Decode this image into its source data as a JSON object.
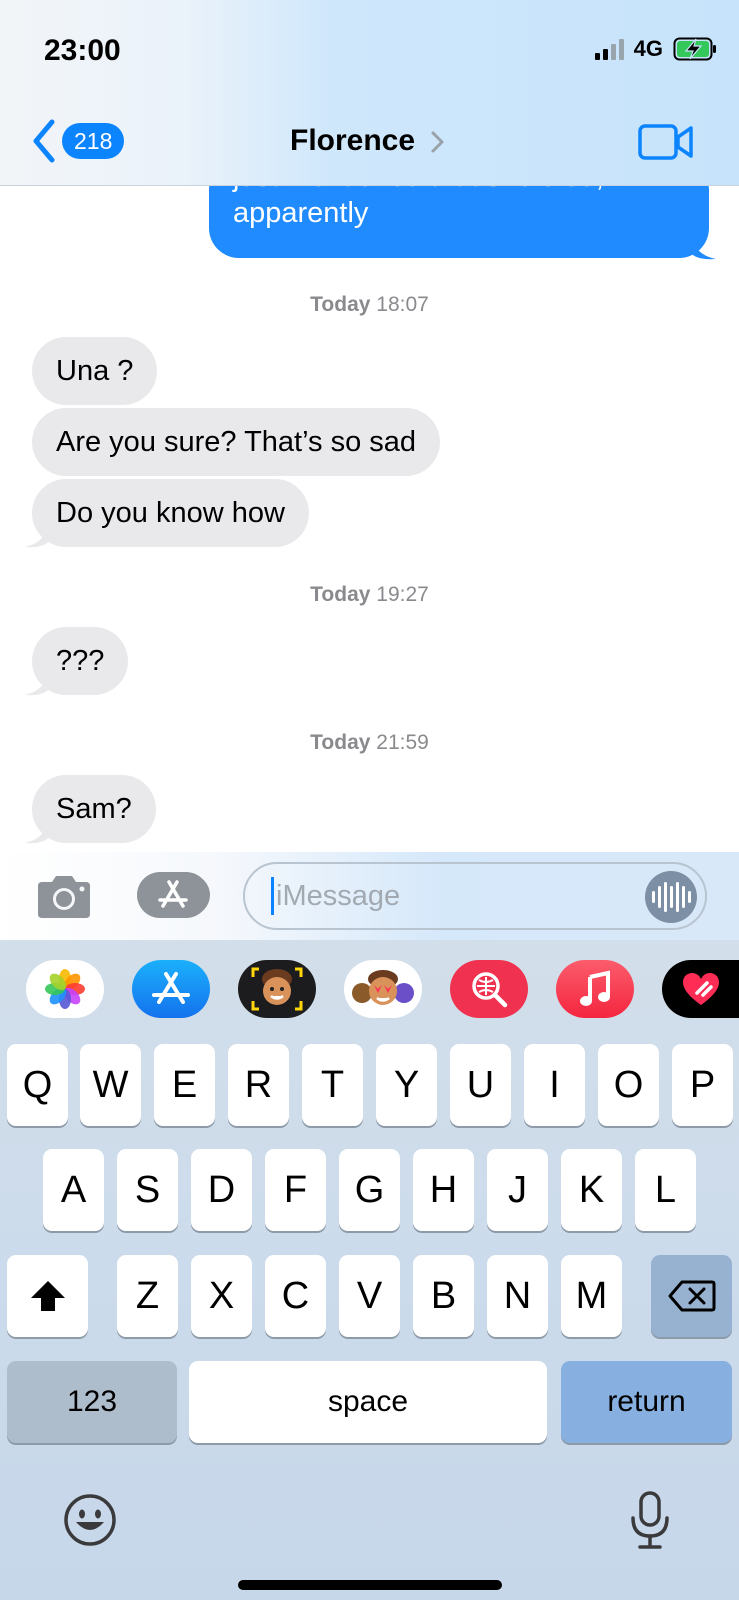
{
  "status_bar": {
    "time": "23:00",
    "network": "4G"
  },
  "nav": {
    "back_count": "218",
    "contact_name": "Florence"
  },
  "messages": {
    "sent_partial": {
      "line1": "just mentioned that she died,",
      "line2": "apparently"
    },
    "stamp1": {
      "day": "Today",
      "time": "18:07"
    },
    "recv1": "Una ?",
    "recv2": "Are you sure? That’s so sad",
    "recv3": "Do you know how",
    "stamp2": {
      "day": "Today",
      "time": "19:27"
    },
    "recv4": "???",
    "stamp3": {
      "day": "Today",
      "time": "21:59"
    },
    "recv5": "Sam?"
  },
  "composer": {
    "placeholder": "iMessage",
    "value": ""
  },
  "app_strip": [
    "photos-app",
    "app-store-app",
    "memoji-app",
    "memoji-stickers-app",
    "image-search-app",
    "music-app",
    "digital-touch-app"
  ],
  "keyboard": {
    "row1": [
      "Q",
      "W",
      "E",
      "R",
      "T",
      "Y",
      "U",
      "I",
      "O",
      "P"
    ],
    "row2": [
      "A",
      "S",
      "D",
      "F",
      "G",
      "H",
      "J",
      "K",
      "L"
    ],
    "row3": [
      "Z",
      "X",
      "C",
      "V",
      "B",
      "N",
      "M"
    ],
    "numbers_label": "123",
    "space_label": "space",
    "return_label": "return"
  },
  "colors": {
    "sent_bubble": "#1f8bff",
    "received_bubble": "#e9e9eb",
    "accent": "#0b84fe"
  }
}
